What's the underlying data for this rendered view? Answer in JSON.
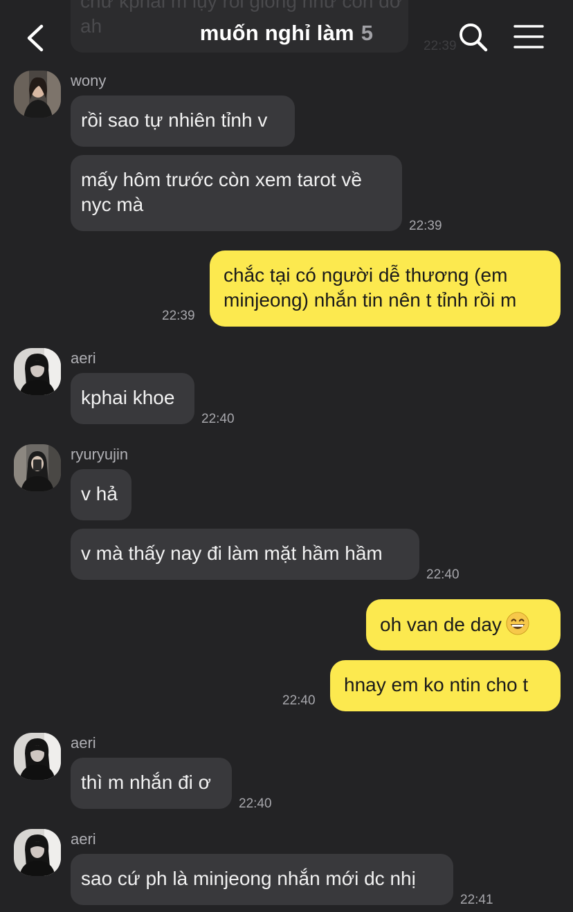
{
  "header": {
    "title": "muốn nghỉ làm",
    "member_count": "5",
    "back_icon": "chevron-left-icon",
    "search_icon": "search-icon",
    "menu_icon": "hamburger-menu-icon"
  },
  "previous_message": {
    "text": "chứ kphải m lụy rồi giống như con dở ah",
    "time": "22:39"
  },
  "messages": [
    {
      "sender": "wony",
      "text": "rồi sao tự nhiên tỉnh v"
    },
    {
      "text_line1": "mấy hôm trước còn xem tarot về",
      "text_line2": "nyc mà",
      "time": "22:39"
    },
    {
      "outgoing": true,
      "text_line1": "chắc tại có người dễ thương (em",
      "text_line2": "minjeong) nhắn tin nên t tỉnh rồi m",
      "time": "22:39"
    },
    {
      "sender": "aeri",
      "text": "kphai khoe",
      "time": "22:40"
    },
    {
      "sender": "ryuryujin",
      "text": "v hả"
    },
    {
      "text": "v mà thấy nay đi làm mặt hầm hầm",
      "time": "22:40"
    },
    {
      "outgoing": true,
      "text": "oh van de day",
      "emoji": "grinning-face-emoji"
    },
    {
      "outgoing": true,
      "text": "hnay em ko ntin cho t",
      "time": "22:40"
    },
    {
      "sender": "aeri",
      "text": "thì m nhắn đi ơ",
      "time": "22:40"
    },
    {
      "sender": "aeri",
      "text": "sao cứ ph là minjeong nhắn mới dc nhị",
      "time": "22:41"
    }
  ],
  "colors": {
    "background": "#232325",
    "incoming_bubble": "#39393c",
    "outgoing_bubble": "#fce94f",
    "timestamp": "#a7a7ac"
  }
}
